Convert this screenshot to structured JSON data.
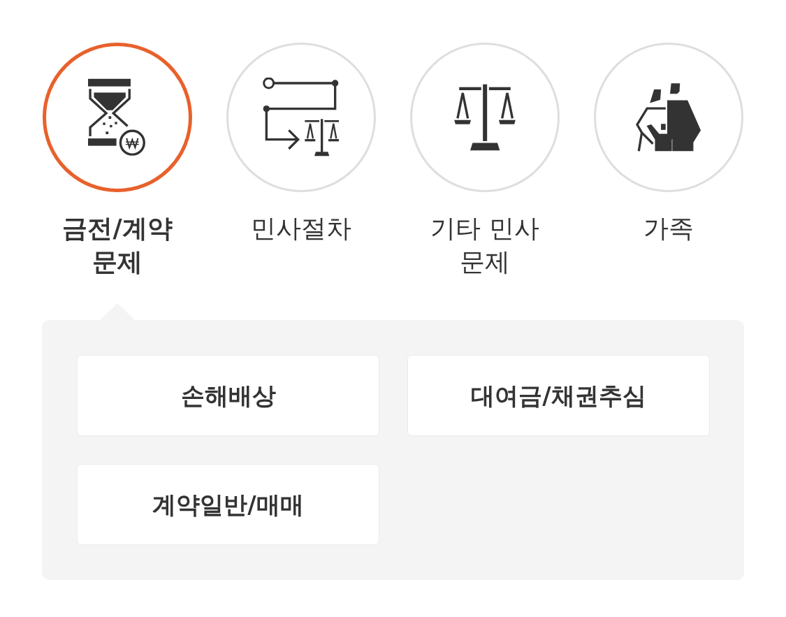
{
  "categories": [
    {
      "kind": "money",
      "label": "금전/계약 문제",
      "selected": true
    },
    {
      "kind": "procedure",
      "label": "민사절차",
      "selected": false
    },
    {
      "kind": "scales",
      "label": "기타 민사 문제",
      "selected": false
    },
    {
      "kind": "family",
      "label": "가족",
      "selected": false
    }
  ],
  "subcategories": [
    {
      "label": "손해배상"
    },
    {
      "label": "대여금/채권추심"
    },
    {
      "label": "계약일반/매매"
    }
  ]
}
